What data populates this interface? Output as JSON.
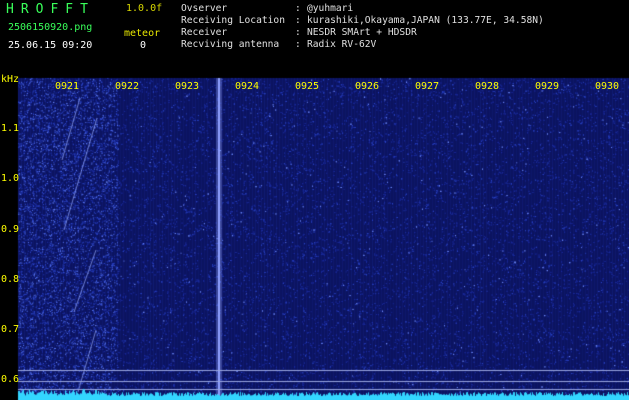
{
  "header": {
    "app_name": "HROFFT",
    "version": "1.0.0f",
    "filename": "2506150920.png",
    "datetime": "25.06.15 09:20",
    "meteor_label": "meteor",
    "meteor_count": "0"
  },
  "info": {
    "rows": [
      {
        "label": "Ovserver",
        "value": "@yuhmari"
      },
      {
        "label": "Receiving Location",
        "value": "kurashiki,Okayama,JAPAN (133.77E, 34.58N)"
      },
      {
        "label": "Receiver",
        "value": "NESDR SMArt + HDSDR"
      },
      {
        "label": "Recviving antenna",
        "value": "Radix RV-62V"
      }
    ],
    "separator": ":"
  },
  "time_axis": {
    "labels": [
      "0921",
      "0922",
      "0923",
      "0924",
      "0925",
      "0926",
      "0927",
      "0928",
      "0929",
      "0930"
    ]
  },
  "freq_axis": {
    "unit": "kHz",
    "labels": [
      "1.1",
      "1.0",
      "0.9",
      "0.8",
      "0.7",
      "0.6"
    ]
  },
  "colors": {
    "background": "#000000",
    "waterfall": "#1a2a9a",
    "header_green": "#39ff5a",
    "header_yellow": "#ffff00",
    "carrier": "#8fa0ff",
    "spectrum": "#33d6ff"
  }
}
